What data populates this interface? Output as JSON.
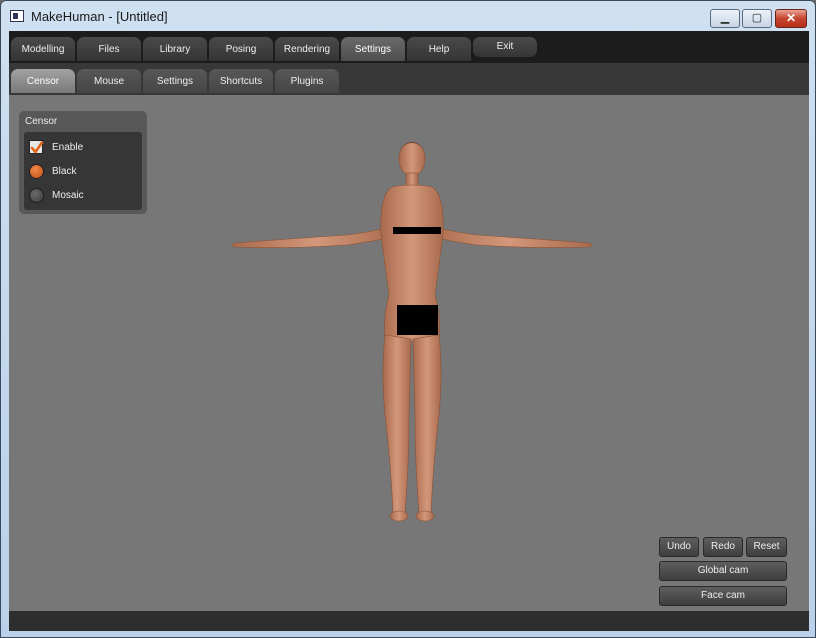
{
  "window": {
    "title": "MakeHuman - [Untitled]",
    "minimize_glyph": "▁",
    "maximize_glyph": "▢",
    "close_glyph": "✕"
  },
  "main_tabs": [
    {
      "label": "Modelling",
      "active": false
    },
    {
      "label": "Files",
      "active": false
    },
    {
      "label": "Library",
      "active": false
    },
    {
      "label": "Posing",
      "active": false
    },
    {
      "label": "Rendering",
      "active": false
    },
    {
      "label": "Settings",
      "active": true
    },
    {
      "label": "Help",
      "active": false
    },
    {
      "label": "Exit",
      "active": false
    }
  ],
  "sub_tabs": [
    {
      "label": "Censor",
      "active": true
    },
    {
      "label": "Mouse",
      "active": false
    },
    {
      "label": "Settings",
      "active": false
    },
    {
      "label": "Shortcuts",
      "active": false
    },
    {
      "label": "Plugins",
      "active": false
    }
  ],
  "censor_panel": {
    "title": "Censor",
    "enable_label": "Enable",
    "enable_checked": true,
    "black_label": "Black",
    "black_selected": true,
    "mosaic_label": "Mosaic",
    "mosaic_selected": false
  },
  "viewport_controls": {
    "undo_label": "Undo",
    "redo_label": "Redo",
    "reset_label": "Reset",
    "global_cam_label": "Global cam",
    "face_cam_label": "Face cam"
  },
  "colors": {
    "accent": "#e0641c",
    "skin": "#c68564",
    "viewport_bg": "#777777"
  }
}
